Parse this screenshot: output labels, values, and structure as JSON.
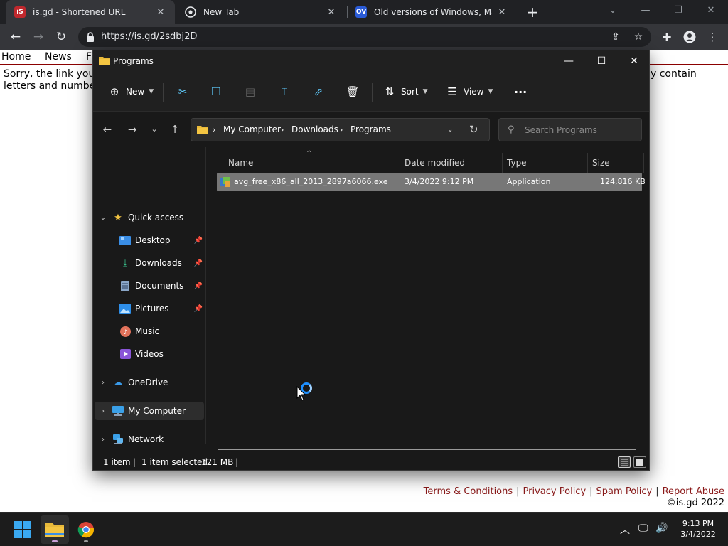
{
  "browser": {
    "tabs": [
      {
        "favicon": "iS",
        "title": "is.gd - Shortened URL",
        "close": "✕"
      },
      {
        "favicon": "",
        "title": "New Tab",
        "close": "✕"
      },
      {
        "favicon": "OV",
        "title": "Old versions of Windows, Mac an",
        "close": "✕"
      }
    ],
    "url": "https://is.gd/2sdbj2D"
  },
  "webpage": {
    "nav": [
      "Home",
      "News",
      "F"
    ],
    "message_left_1": "Sorry, the link you",
    "message_left_2": "letters and numbe",
    "message_right": "y contain",
    "footer_links": [
      "Terms & Conditions",
      "Privacy Policy",
      "Spam Policy",
      "Report Abuse"
    ],
    "copyright": "©is.gd 2022"
  },
  "explorer": {
    "title": "Programs",
    "commands": {
      "new": "New",
      "sort": "Sort",
      "view": "View",
      "more": "···"
    },
    "breadcrumb": [
      "My Computer",
      "Downloads",
      "Programs"
    ],
    "search_placeholder": "Search Programs",
    "nav": {
      "quick_access": "Quick access",
      "desktop": "Desktop",
      "downloads": "Downloads",
      "documents": "Documents",
      "pictures": "Pictures",
      "music": "Music",
      "videos": "Videos",
      "onedrive": "OneDrive",
      "my_computer": "My Computer",
      "network": "Network"
    },
    "columns": {
      "name": "Name",
      "date": "Date modified",
      "type": "Type",
      "size": "Size"
    },
    "files": [
      {
        "name": "avg_free_x86_all_2013_2897a6066.exe",
        "date": "3/4/2022 9:12 PM",
        "type": "Application",
        "size": "124,816 KB"
      }
    ],
    "status": {
      "count": "1 item",
      "selected": "1 item selected",
      "size": "121 MB"
    }
  },
  "taskbar": {
    "time": "9:13 PM",
    "date": "3/4/2022"
  },
  "colors": {
    "accent": "#60cdff",
    "folder": "#f4c542",
    "footer_link": "#8b1a1a"
  }
}
